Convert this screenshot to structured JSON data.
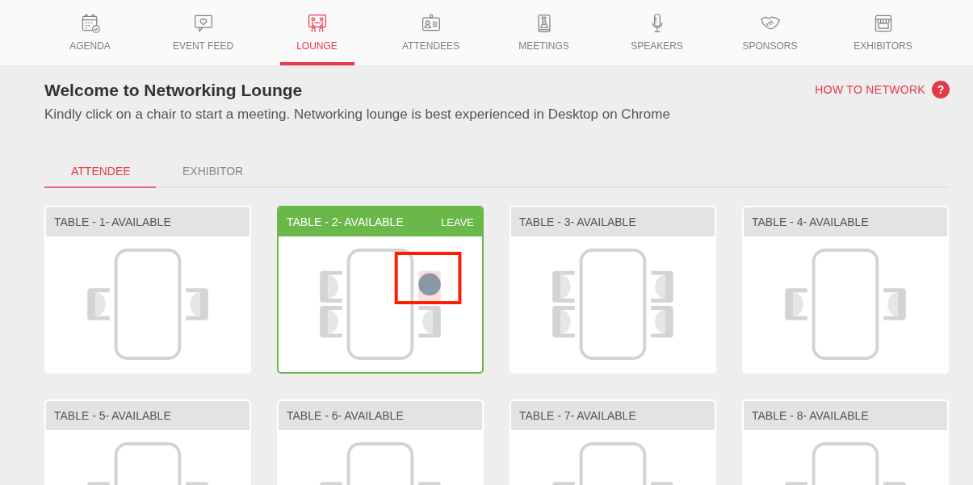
{
  "nav": [
    {
      "label": "AGENDA",
      "selected": false
    },
    {
      "label": "EVENT FEED",
      "selected": false
    },
    {
      "label": "LOUNGE",
      "selected": true
    },
    {
      "label": "ATTENDEES",
      "selected": false
    },
    {
      "label": "MEETINGS",
      "selected": false
    },
    {
      "label": "SPEAKERS",
      "selected": false
    },
    {
      "label": "SPONSORS",
      "selected": false
    },
    {
      "label": "EXHIBITORS",
      "selected": false
    }
  ],
  "header": {
    "title": "Welcome to Networking Lounge",
    "subtitle": "Kindly click on a chair to start a meeting. Networking lounge is best experienced in Desktop on Chrome",
    "help_link": "HOW TO NETWORK",
    "help_icon": "?"
  },
  "tabs": [
    {
      "label": "ATTENDEE",
      "selected": true
    },
    {
      "label": "EXHIBITOR",
      "selected": false
    }
  ],
  "tables": [
    {
      "label": "TABLE - 1- AVAILABLE",
      "joined": false,
      "left_chairs": [
        {
          "occupied": false,
          "highlighted": false
        }
      ],
      "right_chairs": [
        {
          "occupied": false,
          "highlighted": false
        }
      ]
    },
    {
      "label": "TABLE - 2- AVAILABLE",
      "joined": true,
      "action": "LEAVE",
      "left_chairs": [
        {
          "occupied": false,
          "highlighted": false
        },
        {
          "occupied": false,
          "highlighted": false
        }
      ],
      "right_chairs": [
        {
          "occupied": true,
          "highlighted": true
        },
        {
          "occupied": false,
          "highlighted": false
        }
      ]
    },
    {
      "label": "TABLE - 3- AVAILABLE",
      "joined": false,
      "left_chairs": [
        {
          "occupied": false,
          "highlighted": false
        },
        {
          "occupied": false,
          "highlighted": false
        }
      ],
      "right_chairs": [
        {
          "occupied": false,
          "highlighted": false
        },
        {
          "occupied": false,
          "highlighted": false
        }
      ]
    },
    {
      "label": "TABLE - 4- AVAILABLE",
      "joined": false,
      "left_chairs": [
        {
          "occupied": false,
          "highlighted": false
        }
      ],
      "right_chairs": [
        {
          "occupied": false,
          "highlighted": false
        }
      ]
    },
    {
      "label": "TABLE - 5- AVAILABLE",
      "joined": false,
      "left_chairs": [
        {
          "occupied": false
        }
      ],
      "right_chairs": [
        {
          "occupied": false
        }
      ]
    },
    {
      "label": "TABLE - 6- AVAILABLE",
      "joined": false,
      "left_chairs": [
        {
          "occupied": false
        }
      ],
      "right_chairs": [
        {
          "occupied": false
        }
      ]
    },
    {
      "label": "TABLE - 7- AVAILABLE",
      "joined": false,
      "left_chairs": [
        {
          "occupied": false
        }
      ],
      "right_chairs": [
        {
          "occupied": false
        }
      ]
    },
    {
      "label": "TABLE - 8- AVAILABLE",
      "joined": false,
      "left_chairs": [
        {
          "occupied": false
        }
      ],
      "right_chairs": [
        {
          "occupied": false
        }
      ]
    }
  ]
}
